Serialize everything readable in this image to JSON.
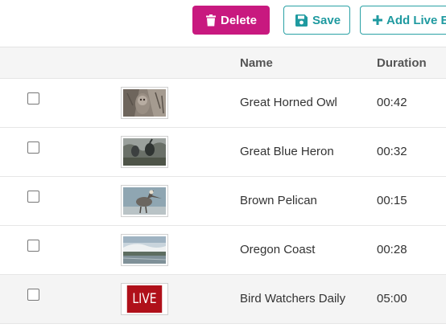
{
  "toolbar": {
    "delete_label": "Delete",
    "save_label": "Save",
    "add_label": "Add Live Ev"
  },
  "table": {
    "columns": [
      "",
      "",
      "Name",
      "Duration"
    ],
    "rows": [
      {
        "name": "Great Horned Owl",
        "duration": "00:42",
        "thumb_icon": "owl-thumbnail"
      },
      {
        "name": "Great Blue Heron",
        "duration": "00:32",
        "thumb_icon": "heron-thumbnail"
      },
      {
        "name": "Brown Pelican",
        "duration": "00:15",
        "thumb_icon": "pelican-thumbnail"
      },
      {
        "name": "Oregon Coast",
        "duration": "00:28",
        "thumb_icon": "coast-thumbnail"
      },
      {
        "name": "Bird Watchers Daily",
        "duration": "05:00",
        "thumb_icon": "live-badge",
        "live_label": "LIVE"
      }
    ]
  },
  "colors": {
    "delete": "#c8197f",
    "accent": "#1f9aa0",
    "live": "#b0101a"
  }
}
